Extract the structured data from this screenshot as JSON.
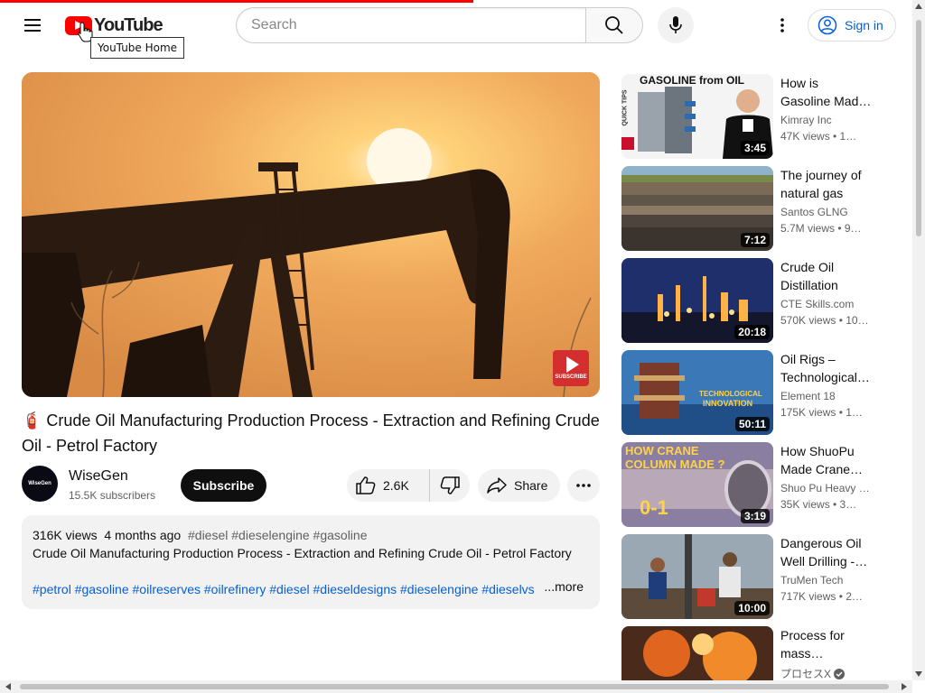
{
  "header": {
    "logo_text": "YouTube",
    "tooltip": "YouTube Home",
    "search_placeholder": "Search",
    "signin_label": "Sign in"
  },
  "video": {
    "title": "🧯 Crude Oil Manufacturing Production Process - Extraction and Refining Crude Oil - Petrol Factory",
    "watermark_label": "SUBSCRIBE"
  },
  "owner": {
    "avatar_text": "WiseGen",
    "channel": "WiseGen",
    "subscribers": "15.5K subscribers",
    "subscribe_label": "Subscribe",
    "likes": "2.6K",
    "share_label": "Share"
  },
  "description": {
    "views": "316K views",
    "age": "4 months ago",
    "tags": "#diesel #dieselengine #gasoline",
    "text": "Crude Oil Manufacturing Production Process  - Extraction and Refining Crude Oil - Petrol Factory",
    "hashtags": "#petrol #gasoline #oilreserves #oilrefinery #diesel #dieseldesigns #dieselengine #dieselvs",
    "more_label": "...more"
  },
  "related": [
    {
      "title1": "How is",
      "title2": "Gasoline Mad…",
      "channel": "Kimray Inc",
      "views": "47K views  • 1…",
      "duration": "3:45",
      "thumb_text": "GASOLINE from OIL",
      "side_text": "QUICK TIPS"
    },
    {
      "title1": "The journey of",
      "title2": "natural gas",
      "channel": "Santos GLNG",
      "views": "5.7M views  • 9…",
      "duration": "7:12"
    },
    {
      "title1": "Crude Oil",
      "title2": "Distillation",
      "channel": "CTE Skills.com",
      "views": "570K views  • 10…",
      "duration": "20:18"
    },
    {
      "title1": "Oil Rigs –",
      "title2": "Technological…",
      "channel": "Element 18",
      "views": "175K views  • 1…",
      "duration": "50:11",
      "thumb_text1": "TECHNOLOGICAL",
      "thumb_text2": "INNOVATION"
    },
    {
      "title1": "How ShuoPu",
      "title2": "Made Crane…",
      "channel": "Shuo Pu Heavy F…",
      "views": "35K views  • 3…",
      "duration": "3:19",
      "thumb_text": "HOW CRANE COLUMN MADE ?"
    },
    {
      "title1": "Dangerous Oil",
      "title2": "Well Drilling -…",
      "channel": "TruMen Tech",
      "views": "717K views  • 2…",
      "duration": "10:00"
    },
    {
      "title1": "Process for",
      "title2": "mass…",
      "channel": "プロセスX",
      "views": ""
    }
  ]
}
